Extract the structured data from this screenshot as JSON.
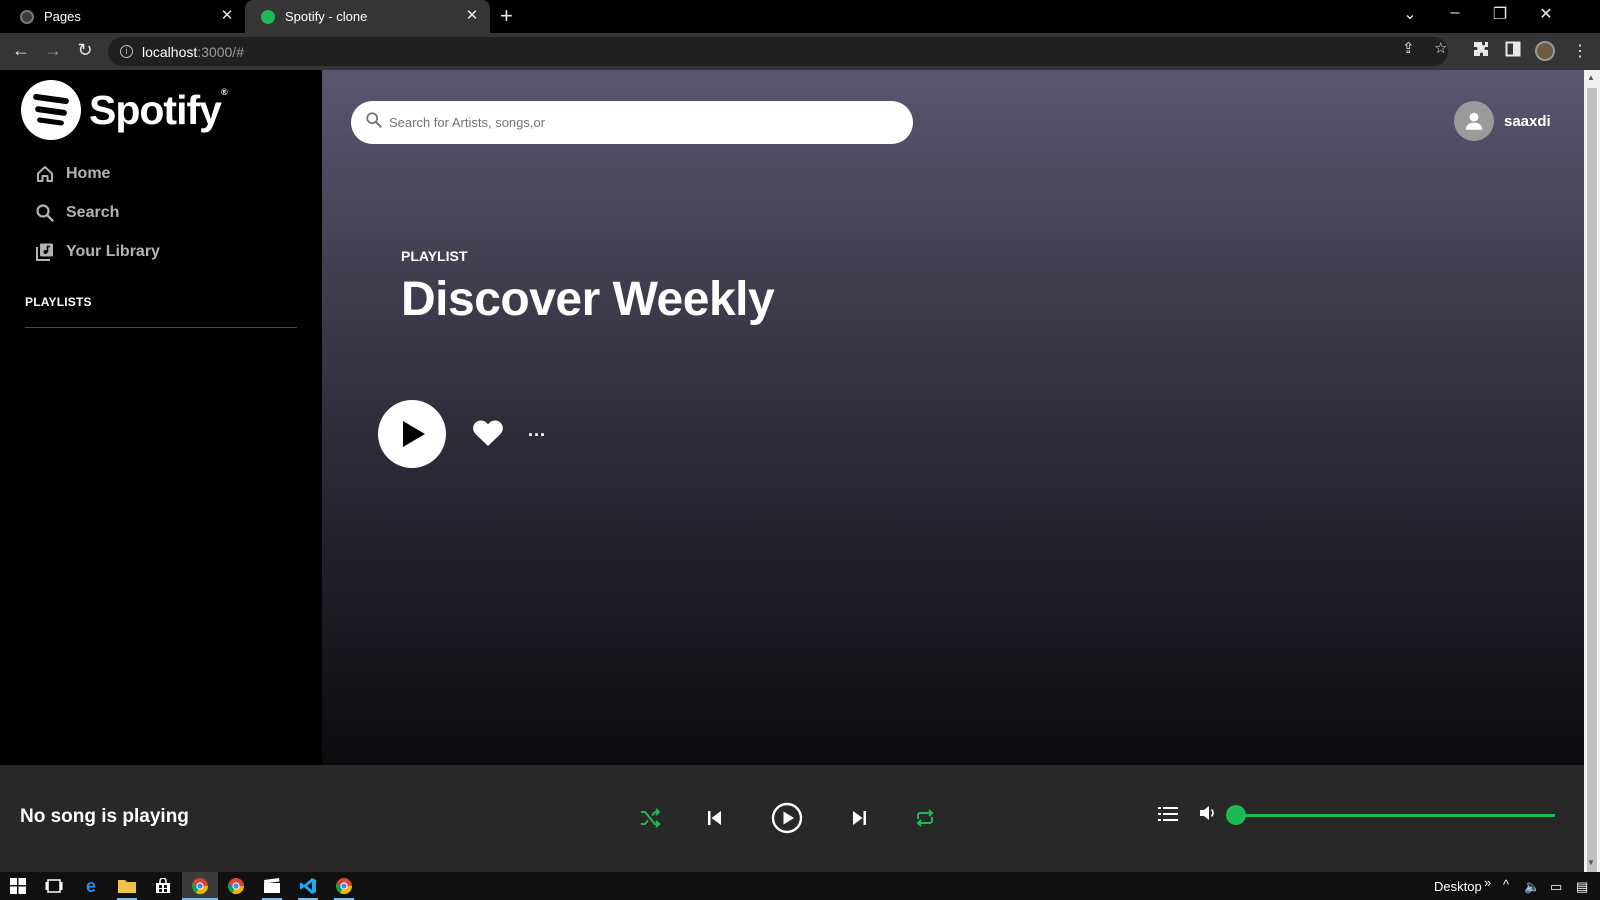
{
  "browser": {
    "tabs": [
      {
        "title": "Pages",
        "icon": "github-icon"
      },
      {
        "title": "Spotify - clone",
        "icon": "spotify-icon"
      }
    ],
    "url_host": "localhost",
    "url_path": ":3000/#"
  },
  "sidebar": {
    "brand": "Spotify",
    "brand_mark": "®",
    "items": [
      {
        "label": "Home",
        "icon": "home-icon"
      },
      {
        "label": "Search",
        "icon": "search-icon"
      },
      {
        "label": "Your Library",
        "icon": "library-icon"
      }
    ],
    "playlists_title": "PLAYLISTS"
  },
  "header": {
    "search_placeholder": "Search for Artists, songs,or",
    "username": "saaxdi"
  },
  "playlist": {
    "type_label": "PLAYLIST",
    "name": "Discover Weekly",
    "more": "..."
  },
  "player": {
    "now_playing": "No song is playing",
    "volume": 0.0,
    "accent": "#1db954"
  },
  "taskbar": {
    "desktop_label": "Desktop"
  }
}
